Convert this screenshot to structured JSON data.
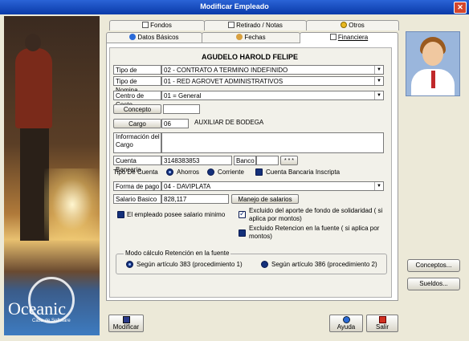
{
  "window": {
    "title": "Modificar Empleado",
    "close": "✕"
  },
  "branding": {
    "logo": "Oceanic",
    "tagline": "Casa de Software"
  },
  "tabs": {
    "row1": [
      {
        "label": "Fondos"
      },
      {
        "label": "Retirado / Notas"
      },
      {
        "label": "Otros"
      }
    ],
    "row2": [
      {
        "label": "Datos Básicos"
      },
      {
        "label": "Fechas"
      },
      {
        "label": "Financiera"
      }
    ]
  },
  "employee": {
    "name": "AGUDELO  HAROLD FELIPE"
  },
  "form": {
    "tipo_contrato": {
      "label": "Tipo de Contrato",
      "value": "02 - CONTRATO A TERMINO INDEFINIDO"
    },
    "tipo_nomina": {
      "label": "Tipo de Nomina",
      "value": "01 - RED AGROVET ADMINISTRATIVOS"
    },
    "centro_costo": {
      "label": "Centro de Costo",
      "value": "01 = General"
    },
    "concepto": {
      "label": "Concepto",
      "value": ""
    },
    "cargo": {
      "label": "Cargo",
      "code": "06",
      "desc": "AUXILIAR DE BODEGA"
    },
    "info_cargo": {
      "label": "Información del Cargo",
      "value": ""
    },
    "cuenta_bancaria": {
      "label": "Cuenta Bancaria",
      "value": "3148383853"
    },
    "banco": {
      "label": "Banco",
      "value": "",
      "button": "* * *"
    },
    "tipo_cuenta": {
      "label": "Tipo De Cuenta",
      "ahorros": "Ahorros",
      "corriente": "Corriente",
      "inscrita": "Cuenta Bancaria Inscripta"
    },
    "forma_pago": {
      "label": "Forma de pago",
      "value": "04 - DAVIPLATA"
    },
    "salario": {
      "label": "Salario Basico",
      "value": "828,117",
      "button": "Manejo de salarios"
    },
    "salario_minimo": "El empleado posee salario minimo",
    "excluido_aporte": "Excluido del aporte de fondo de solidaridad ( si aplica por montos)",
    "excluido_retencion": "Excluido Retencion en la fuente ( si aplica por montos)",
    "retencion": {
      "title": "Modo cálculo Retención en la fuente",
      "opt1": "Según artículo 383 (procedimiento 1)",
      "opt2": "Según artículo 386 (procedimiento 2)"
    }
  },
  "buttons": {
    "modificar": "Modificar",
    "ayuda": "Ayuda",
    "salir": "Salir",
    "conceptos": "Conceptos...",
    "sueldos": "Sueldos..."
  },
  "colors": {
    "titlebar": "#0a3aa8",
    "radio": "#14307a"
  }
}
